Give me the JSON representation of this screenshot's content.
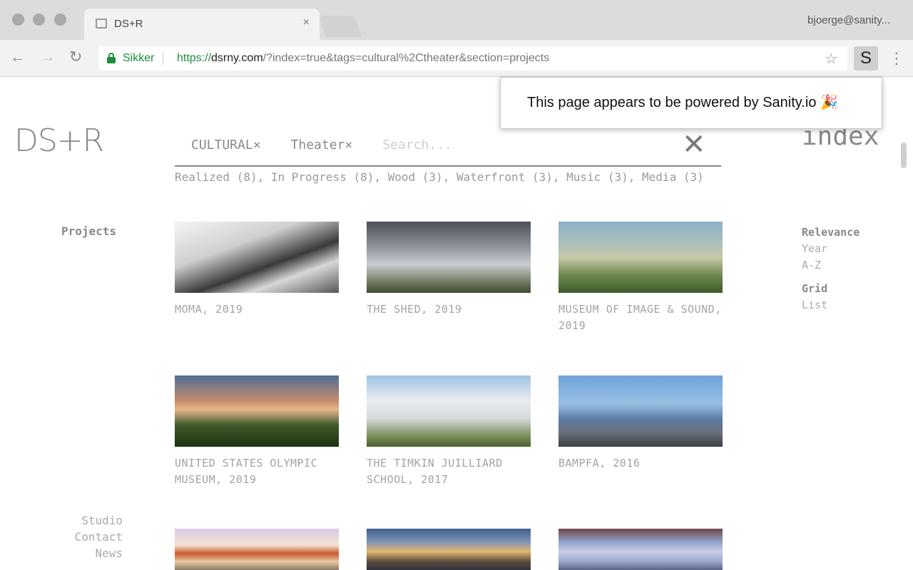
{
  "browser": {
    "tab_title": "DS+R",
    "tab_close": "×",
    "profile_name": "bjoerge@sanity...",
    "back": "←",
    "forward": "→",
    "reload": "↻",
    "secure_label": "Sikker",
    "url_scheme": "https://",
    "url_host": "dsrny.com",
    "url_rest": "/?index=true&tags=cultural%2Ctheater&section=projects",
    "star": "☆",
    "extension_letter": "S",
    "menu": "⋮"
  },
  "popup": {
    "message": "This page appears to be powered by Sanity.io 🎉"
  },
  "site": {
    "logo": "DS+R",
    "index_label": "index",
    "filters": {
      "tags": [
        "CULTURAL×",
        "Theater×"
      ],
      "search_placeholder": "Search...",
      "clear": "✕"
    },
    "facets": "Realized (8), In Progress (8), Wood (3), Waterfront (3), Music (3), Media (3)",
    "section_label": "Projects",
    "sort": {
      "relevance": "Relevance",
      "year": "Year",
      "az": "A-Z",
      "grid": "Grid",
      "list": "List"
    },
    "nav": {
      "studio": "Studio",
      "contact": "Contact",
      "news": "News"
    },
    "projects": [
      {
        "caption": "MOMA, 2019"
      },
      {
        "caption": "THE SHED, 2019"
      },
      {
        "caption": "MUSEUM OF IMAGE & SOUND, 2019"
      },
      {
        "caption": "UNITED STATES OLYMPIC MUSEUM, 2019"
      },
      {
        "caption": "THE TIMKIN JUILLIARD SCHOOL, 2017"
      },
      {
        "caption": "BAMPFA, 2016"
      }
    ]
  }
}
